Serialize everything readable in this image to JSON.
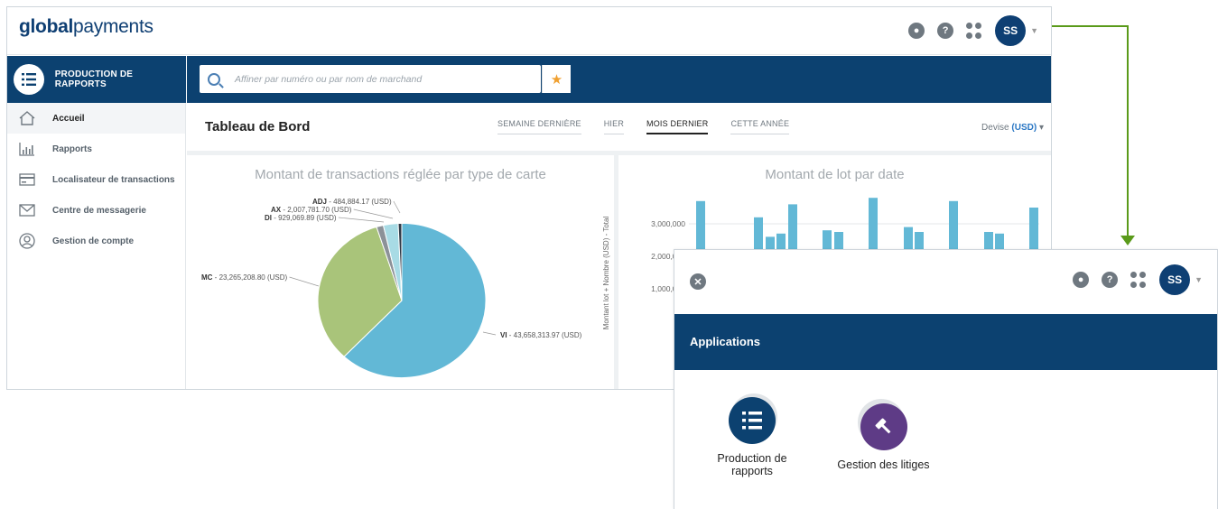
{
  "brand": {
    "bold": "global",
    "light": "payments"
  },
  "topbar": {
    "avatar_initials": "SS"
  },
  "side_header": {
    "label": "PRODUCTION DE RAPPORTS"
  },
  "search": {
    "placeholder": "Affiner par numéro ou par nom de marchand"
  },
  "sidebar": {
    "items": [
      {
        "label": "Accueil",
        "icon": "home-icon",
        "active": true
      },
      {
        "label": "Rapports",
        "icon": "bar-chart-icon"
      },
      {
        "label": "Localisateur de transactions",
        "icon": "card-icon"
      },
      {
        "label": "Centre de messagerie",
        "icon": "envelope-icon"
      },
      {
        "label": "Gestion de compte",
        "icon": "user-circle-icon"
      }
    ]
  },
  "dashboard": {
    "title": "Tableau de Bord",
    "tabs": [
      {
        "label": "SEMAINE DERNIÈRE"
      },
      {
        "label": "HIER"
      },
      {
        "label": "MOIS DERNIER",
        "active": true
      },
      {
        "label": "CETTE ANNÉE"
      }
    ],
    "devise_label": "Devise",
    "devise_value": "(USD)"
  },
  "chart_data": [
    {
      "type": "pie",
      "title": "Montant de transactions réglée par type de carte",
      "slices": [
        {
          "name": "VI",
          "value": 43658313.97,
          "label": " - 43,658,313.97 (USD)",
          "color": "#62b8d6"
        },
        {
          "name": "MC",
          "value": 23265208.8,
          "label": " - 23,265,208.80 (USD)",
          "color": "#a9c47a"
        },
        {
          "name": "DI",
          "value": 929069.89,
          "label": " - 929,069.89 (USD)",
          "color": "#8c9198"
        },
        {
          "name": "AX",
          "value": 2007781.7,
          "label": " - 2,007,781.70 (USD)",
          "color": "#a8dbe5"
        },
        {
          "name": "ADJ",
          "value": 484884.17,
          "label": " - 484,884.17 (USD)",
          "color": "#2f3a47"
        }
      ]
    },
    {
      "type": "bar",
      "title": "Montant de lot par date",
      "ylabel": "Montant lot + Nombre (USD) - Total",
      "yticks": [
        "3,000,000",
        "2,000,000",
        "1,000,000"
      ],
      "ylim": [
        0,
        4000000
      ],
      "values": [
        3700000,
        3200000,
        2600000,
        2700000,
        3600000,
        2800000,
        2750000,
        3800000,
        2900000,
        2750000,
        3700000,
        2750000,
        2700000,
        3500000
      ],
      "color": "#62b8d6"
    }
  ],
  "overlay": {
    "avatar_initials": "SS",
    "band_title": "Applications",
    "apps": [
      {
        "label": "Production de rapports",
        "color": "#0c4170",
        "icon": "list-icon"
      },
      {
        "label": "Gestion des litiges",
        "color": "#5e3b86",
        "icon": "gavel-icon"
      }
    ]
  },
  "connector_color": "#5a9a1a"
}
